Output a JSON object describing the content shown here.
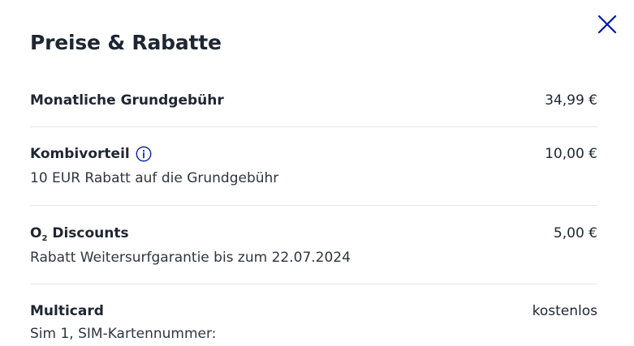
{
  "dialog": {
    "title": "Preise & Rabatte",
    "close_label": "Schließen"
  },
  "items": [
    {
      "label": "Monatliche Grundgebühr",
      "price": "34,99 €",
      "description": ""
    },
    {
      "label": "Kombivorteil",
      "price": "10,00 €",
      "description": "10 EUR Rabatt auf die Grundgebühr",
      "info_icon": "info-circle-icon"
    },
    {
      "label_prefix": "O",
      "label_subscript": "2",
      "label": "Discounts",
      "price": "5,00 €",
      "description": "Rabatt Weitersurfgarantie bis zum 22.07.2024"
    },
    {
      "label": "Multicard",
      "price": "kostenlos",
      "description": "Sim 1, SIM-Kartennummer:"
    }
  ],
  "colors": {
    "text": "#1f2633",
    "accent": "#0019a5",
    "divider": "#e3e6ea"
  }
}
